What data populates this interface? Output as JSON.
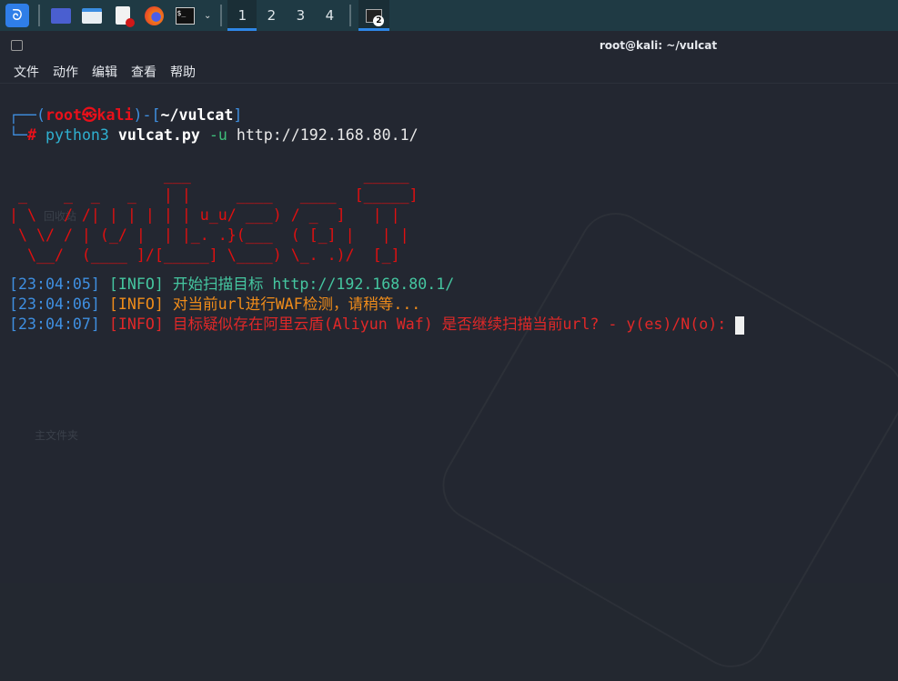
{
  "taskbar": {
    "workspaces": [
      "1",
      "2",
      "3",
      "4"
    ],
    "active_workspace": "1",
    "task_badge": "2",
    "colors": {
      "accent": "#2e86e6"
    }
  },
  "window": {
    "title": "root@kali: ~/vulcat",
    "menu": [
      "文件",
      "动作",
      "编辑",
      "查看",
      "帮助"
    ]
  },
  "desktop": {
    "icons": [
      "回收站",
      "主文件夹"
    ]
  },
  "prompt": {
    "user": "root",
    "host": "kali",
    "dir": "~/vulcat",
    "symbol": "#",
    "cmd": "python3",
    "script": "vulcat.py",
    "flag": "-u",
    "url": "http://192.168.80.1/"
  },
  "banner": [
    "                 ___                   _____",
    " _    _  _   _   | |     ____   ____  [_____]",
    "| \\   / /| | | | | | u_u/ ___) / _  ]   | |",
    " \\ \\/ / | (_/ |  | |_. .}(___  ( [_] |   | |",
    "  \\__/  (____ ]/[_____] \\____) \\_. .)/  [_]"
  ],
  "log": [
    {
      "time": "[23:04:05]",
      "level": "[INFO]",
      "msg": "开始扫描目标 http://192.168.80.1/",
      "color": "#45c6a0"
    },
    {
      "time": "[23:04:06]",
      "level": "[INFO]",
      "msg": "对当前url进行WAF检测，请稍等...",
      "color": "#f08c1a"
    },
    {
      "time": "[23:04:07]",
      "level": "[INFO]",
      "msg": "目标疑似存在阿里云盾(Aliyun Waf) 是否继续扫描当前url? - y(es)/N(o):",
      "color": "#e02828"
    }
  ]
}
